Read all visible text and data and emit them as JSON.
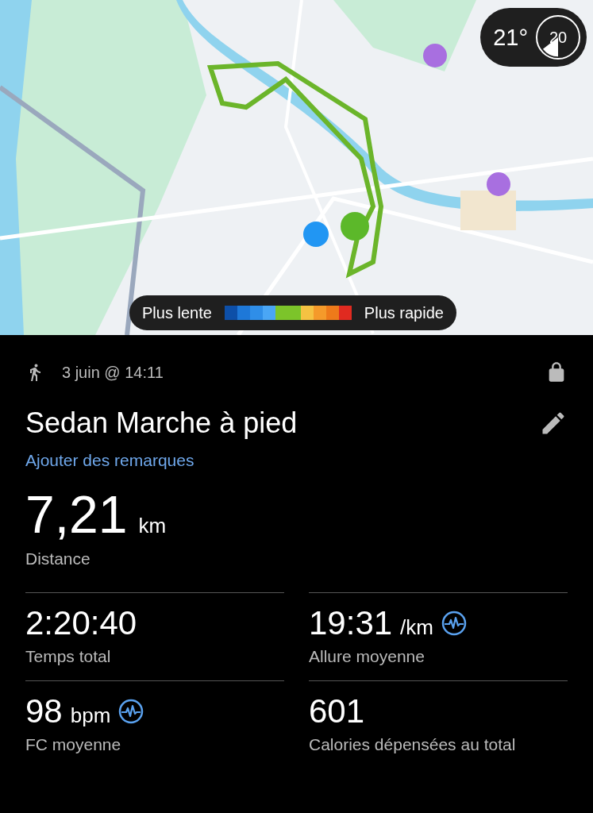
{
  "map": {
    "badge": {
      "temperature": "21°",
      "dial_value": "20"
    },
    "legend": {
      "slow_label": "Plus lente",
      "fast_label": "Plus rapide",
      "swatches": [
        {
          "color": "#0d4fa8"
        },
        {
          "color": "#1e78d8"
        },
        {
          "color": "#2f8ee8"
        },
        {
          "color": "#4aa6f5"
        },
        {
          "color": "#7cc42a"
        },
        {
          "color": "#7cc42a"
        },
        {
          "color": "#f5c242"
        },
        {
          "color": "#f59a2a"
        },
        {
          "color": "#ee7a1a"
        },
        {
          "color": "#e02a20"
        }
      ]
    }
  },
  "activity": {
    "date": "3 juin @ 14:11",
    "locked": true,
    "title": "Sedan Marche à pied",
    "notes_link": "Ajouter des remarques"
  },
  "distance": {
    "value": "7,21",
    "unit": "km",
    "label": "Distance"
  },
  "stats": [
    {
      "value": "2:20:40",
      "label": "Temps total",
      "pulse_icon": false
    },
    {
      "value": "19:31",
      "unit": "/km",
      "label": "Allure moyenne",
      "pulse_icon": true
    },
    {
      "value": "98",
      "unit": "bpm",
      "label": "FC moyenne",
      "pulse_icon": true
    },
    {
      "value": "601",
      "label": "Calories dépensées au total",
      "pulse_icon": false
    }
  ]
}
